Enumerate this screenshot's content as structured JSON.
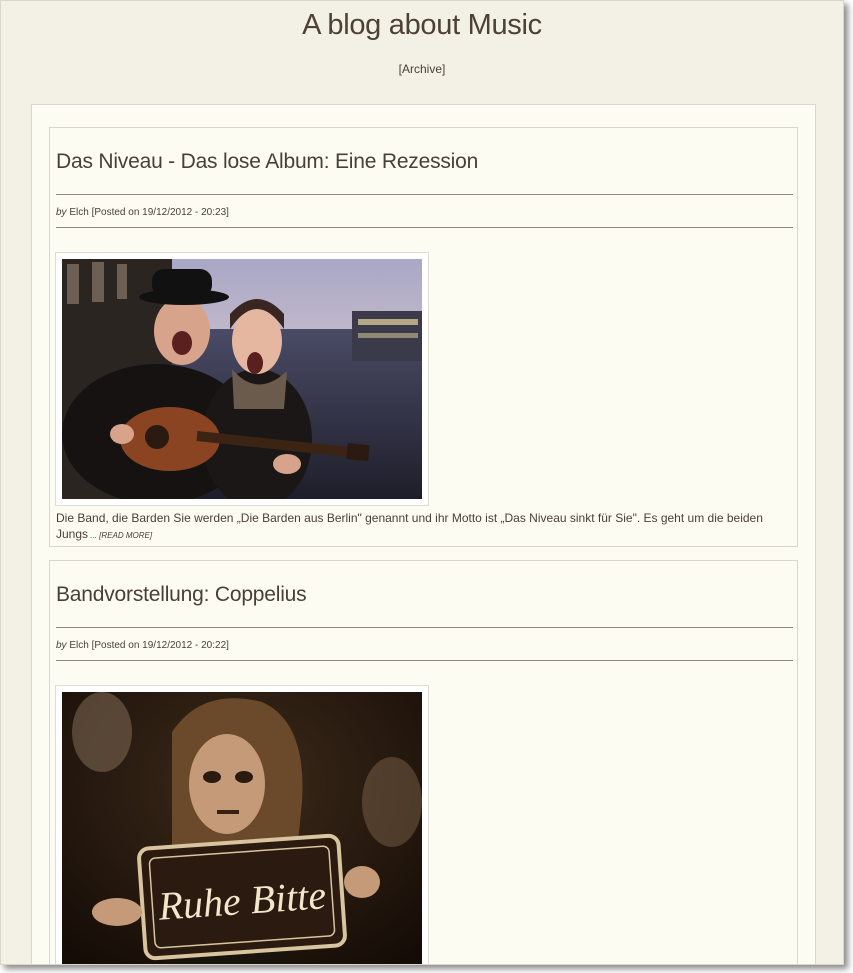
{
  "site": {
    "title": "A blog about Music",
    "archive_link": "[Archive]"
  },
  "posts": [
    {
      "title": "Das Niveau - Das lose Album: Eine Rezession",
      "by_label": "by",
      "author": "Elch",
      "posted": "[Posted on 19/12/2012 - 20:23]",
      "image_description": "two musicians shouting, one holding an acoustic guitar, by a river at dusk",
      "excerpt": "Die Band, die Barden Sie werden „Die Barden aus Berlin\" genannt und ihr Motto ist „Das Niveau sinkt für Sie\". Es geht um die beiden Jungs",
      "ellipsis": " ... ",
      "read_more": "[READ MORE]"
    },
    {
      "title": "Bandvorstellung: Coppelius",
      "by_label": "by",
      "author": "Elch",
      "posted": "[Posted on 19/12/2012 - 20:22]",
      "image_description": "sepia photo of a performer in makeup holding a sign",
      "sign_text": "Ruhe Bitte"
    }
  ]
}
